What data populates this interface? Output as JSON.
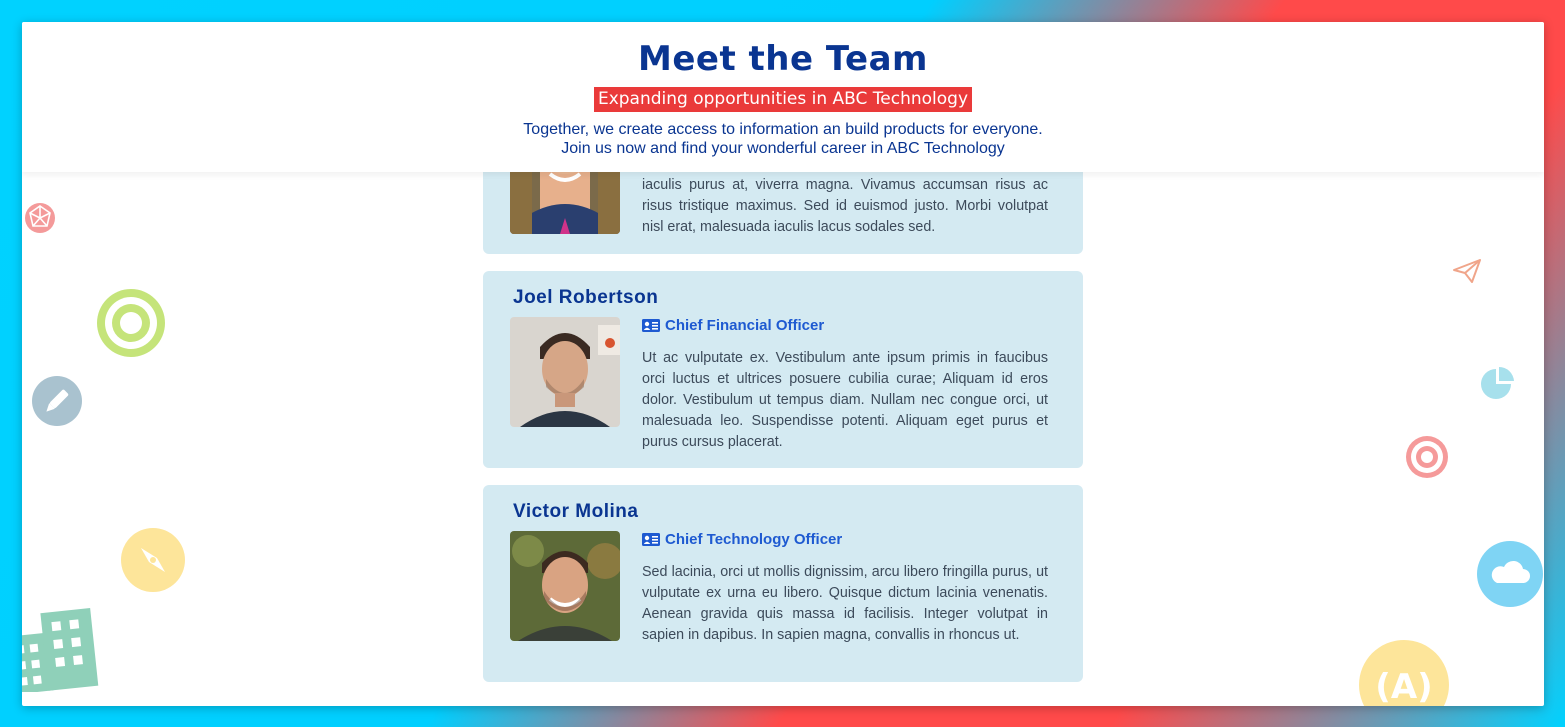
{
  "header": {
    "title": "Meet the Team",
    "subtitle": "Expanding opportunities in ABC Technology",
    "intro_line1": "Together, we create access to information an build products for everyone.",
    "intro_line2": "Join us now and find your wonderful career in ABC Technology"
  },
  "team": [
    {
      "bio_visible": "iaculis purus at, viverra magna. Vivamus accumsan risus ac risus tristique maximus. Sed id euismod justo. Morbi volutpat nisl erat, malesuada iaculis lacus sodales sed."
    },
    {
      "name": "Joel Robertson",
      "role": "Chief Financial Officer",
      "bio": "Ut ac vulputate ex. Vestibulum ante ipsum primis in faucibus orci luctus et ultrices posuere cubilia curae; Aliquam id eros dolor. Vestibulum ut tempus diam. Nullam nec congue orci, ut malesuada leo. Suspendisse potenti. Aliquam eget purus et purus cursus placerat."
    },
    {
      "name": "Victor Molina",
      "role": "Chief Technology Officer",
      "bio": "Sed lacinia, orci ut mollis dignissim, arcu libero fringilla purus, ut vulputate ex urna eu libero. Quisque dictum lacinia venenatis. Aenean gravida quis massa id facilisis. Integer volutpat in sapien in dapibus. In sapien magna, convallis in rhoncus ut."
    }
  ],
  "icons": {
    "role": "id-card-icon",
    "decorations": [
      "network-sphere-icon",
      "target-icon",
      "pen-icon",
      "compass-icon",
      "building-icon",
      "paper-plane-icon",
      "pie-chart-icon",
      "target-icon",
      "cloud-icon",
      "broadcast-icon"
    ]
  },
  "colors": {
    "title": "#0a3591",
    "subtitle_bg": "#ea3a3a",
    "card_bg": "#d4eaf2",
    "role": "#1e5ad1",
    "frame_gradient_blue": "#00d2ff",
    "frame_gradient_red": "#ff4a4a"
  }
}
